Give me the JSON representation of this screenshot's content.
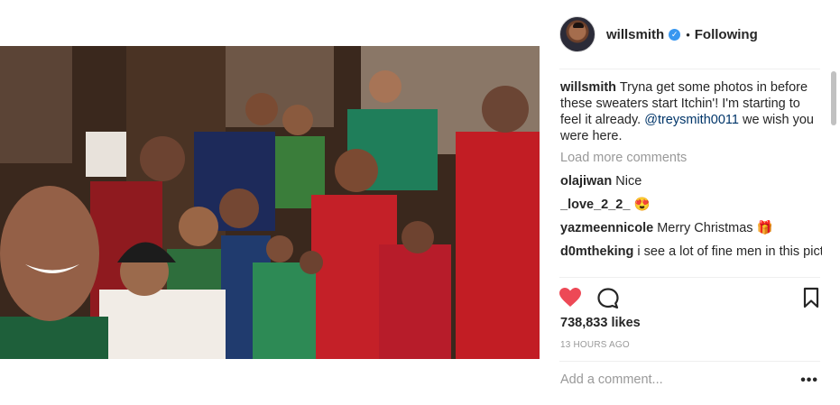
{
  "post": {
    "username": "willsmith",
    "following_label": "Following",
    "caption_user": "willsmith",
    "caption_text": "Tryna get some photos in before these sweaters start Itchin'! I'm starting to feel it already.",
    "caption_mention": "@treysmith0011",
    "caption_tail": "we wish you were here.",
    "load_more": "Load more comments",
    "comments": [
      {
        "user": "olajiwan",
        "text": "Nice"
      },
      {
        "user": "_love_2_2_",
        "text": "😍"
      },
      {
        "user": "yazmeennicole",
        "text": "Merry Christmas 🎁"
      },
      {
        "user": "d0mtheking",
        "text": "i see a lot of fine men in this picture"
      }
    ],
    "likes": "738,833 likes",
    "time_ago": "13 HOURS AGO",
    "add_comment_placeholder": "Add a comment...",
    "more_options": "•••"
  },
  "icons": {
    "verified": "verified-badge-icon",
    "like": "heart-icon",
    "comment": "comment-bubble-icon",
    "save": "bookmark-icon"
  },
  "colors": {
    "like_active": "#ed4956",
    "verified": "#3897f0",
    "mention": "#003569",
    "muted": "#999999"
  }
}
